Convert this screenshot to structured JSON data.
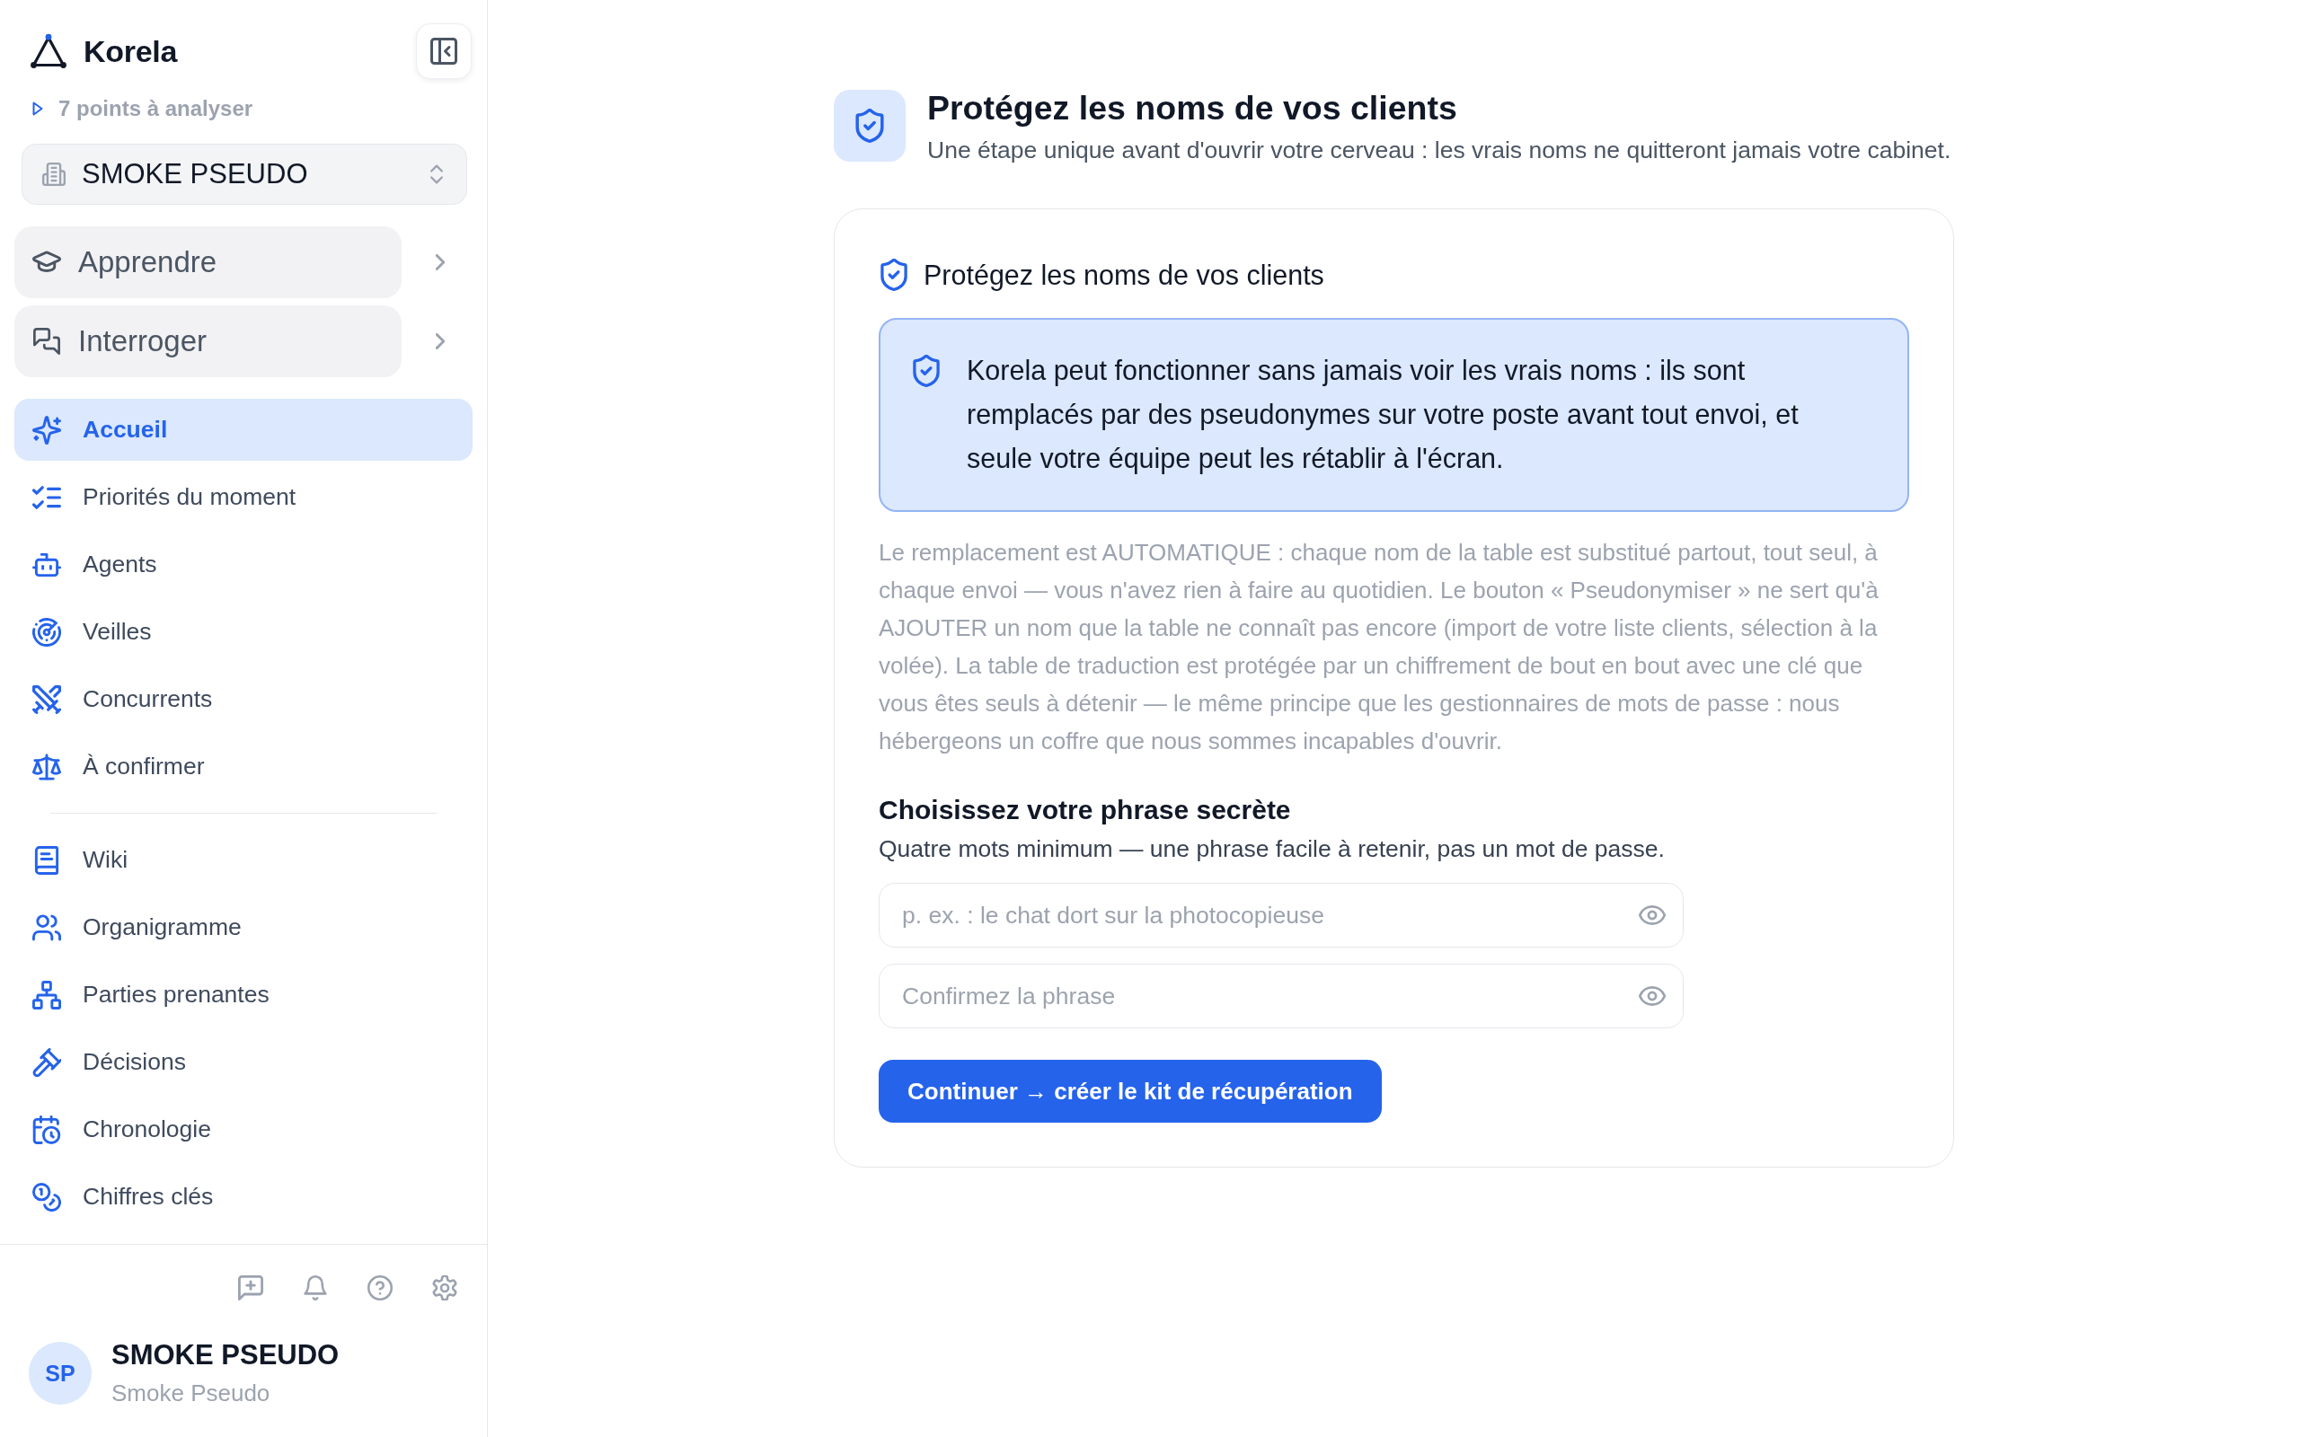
{
  "sidebar": {
    "brand": "Korela",
    "pending": "7 points à analyser",
    "workspace": "SMOKE PSEUDO",
    "groups": [
      {
        "label": "Apprendre",
        "expanded": false
      },
      {
        "label": "Interroger",
        "expanded": false
      }
    ],
    "nav": [
      {
        "items": [
          {
            "label": "Accueil",
            "selected": true
          },
          {
            "label": "Priorités du moment",
            "selected": false
          },
          {
            "label": "Agents",
            "selected": false
          },
          {
            "label": "Veilles",
            "selected": false
          },
          {
            "label": "Concurrents",
            "selected": false
          },
          {
            "label": "À confirmer",
            "selected": false
          }
        ]
      },
      {
        "items": [
          {
            "label": "Wiki",
            "selected": false
          },
          {
            "label": "Organigramme",
            "selected": false
          },
          {
            "label": "Parties prenantes",
            "selected": false
          },
          {
            "label": "Décisions",
            "selected": false
          },
          {
            "label": "Chronologie",
            "selected": false
          },
          {
            "label": "Chiffres clés",
            "selected": false
          }
        ]
      }
    ],
    "user": {
      "initials": "SP",
      "name": "SMOKE PSEUDO",
      "subtitle": "Smoke Pseudo"
    }
  },
  "main": {
    "header": {
      "title": "Protégez les noms de vos clients",
      "subtitle": "Une étape unique avant d'ouvrir votre cerveau : les vrais noms ne quitteront jamais votre cabinet."
    },
    "card": {
      "title": "Protégez les noms de vos clients",
      "notice": "Korela peut fonctionner sans jamais voir les vrais noms : ils sont remplacés par des pseudonymes sur votre poste avant tout envoi, et seule votre équipe peut les rétablir à l'écran.",
      "description": "Le remplacement est AUTOMATIQUE : chaque nom de la table est substitué partout, tout seul, à chaque envoi — vous n'avez rien à faire au quotidien. Le bouton « Pseudonymiser » ne sert qu'à AJOUTER un nom que la table ne connaît pas encore (import de votre liste clients, sélection à la volée). La table de traduction est protégée par un chiffrement de bout en bout avec une clé que vous êtes seuls à détenir — le même principe que les gestionnaires de mots de passe : nous hébergeons un coffre que nous sommes incapables d'ouvrir.",
      "passphrase": {
        "title": "Choisissez votre phrase secrète",
        "hint": "Quatre mots minimum — une phrase facile à retenir, pas un mot de passe.",
        "fields": [
          {
            "placeholder": "p. ex. : le chat dort sur la photocopieuse"
          },
          {
            "placeholder": "Confirmez la phrase"
          }
        ],
        "submit": "Continuer → créer le kit de récupération"
      }
    }
  }
}
